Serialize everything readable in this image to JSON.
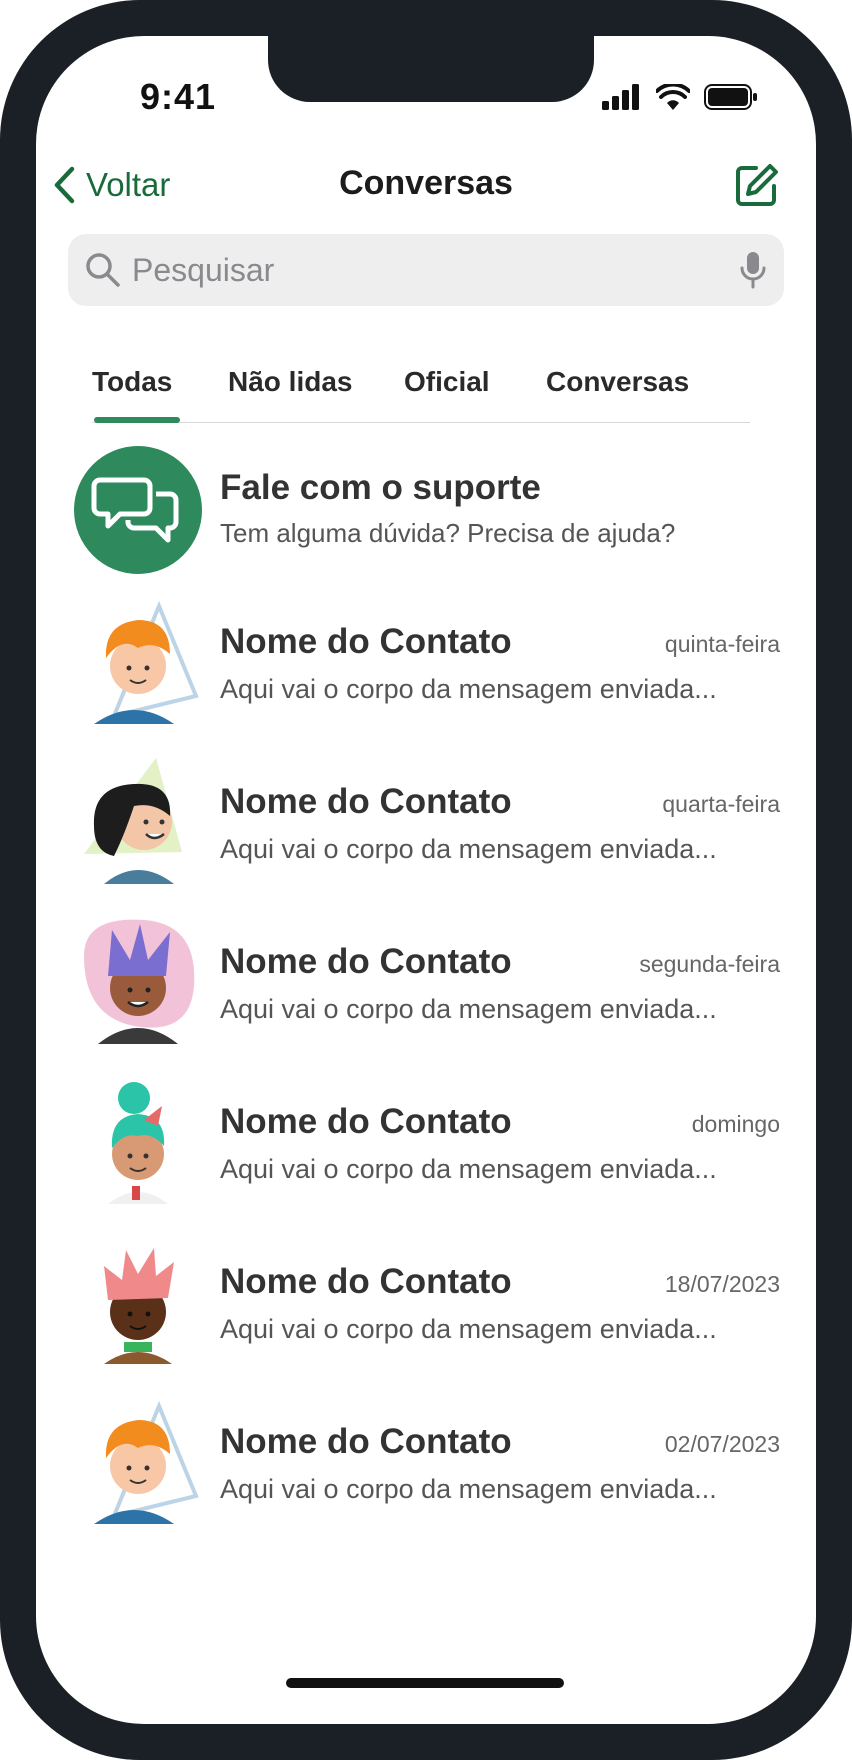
{
  "status": {
    "time": "9:41"
  },
  "nav": {
    "back_label": "Voltar",
    "title": "Conversas"
  },
  "search": {
    "placeholder": "Pesquisar"
  },
  "tabs": [
    {
      "label": "Todas",
      "active": true
    },
    {
      "label": "Não lidas"
    },
    {
      "label": "Oficial"
    },
    {
      "label": "Conversas"
    }
  ],
  "support": {
    "title": "Fale com o suporte",
    "subtitle": "Tem alguma dúvida? Precisa de ajuda?"
  },
  "conversations": [
    {
      "name": "Nome do Contato",
      "date": "quinta-feira",
      "message": "Aqui vai o corpo da mensagem enviada..."
    },
    {
      "name": "Nome do Contato",
      "date": "quarta-feira",
      "message": "Aqui vai o corpo da mensagem enviada..."
    },
    {
      "name": "Nome do Contato",
      "date": "segunda-feira",
      "message": "Aqui vai o corpo da mensagem enviada..."
    },
    {
      "name": "Nome do Contato",
      "date": "domingo",
      "message": "Aqui vai o corpo da mensagem enviada..."
    },
    {
      "name": "Nome do Contato",
      "date": "18/07/2023",
      "message": "Aqui vai o corpo da mensagem enviada..."
    },
    {
      "name": "Nome do Contato",
      "date": "02/07/2023",
      "message": "Aqui vai o corpo da mensagem enviada..."
    }
  ],
  "colors": {
    "accent": "#1a6b3c",
    "support_badge": "#2e8a5c",
    "tab_indicator": "#2e8a5c"
  },
  "icons": [
    "chevron-left-icon",
    "compose-icon",
    "search-icon",
    "microphone-icon",
    "chat-bubbles-icon",
    "signal-icon",
    "wifi-icon",
    "battery-icon"
  ]
}
